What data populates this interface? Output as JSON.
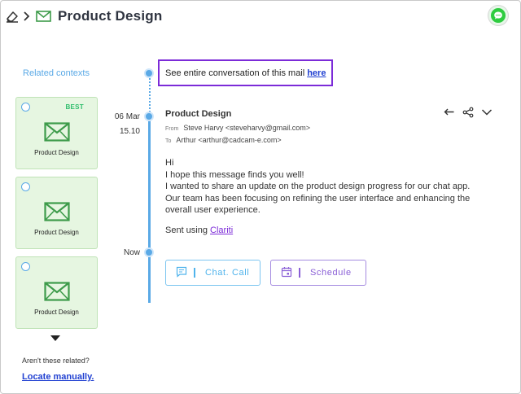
{
  "header": {
    "title": "Product Design",
    "icons": [
      "eraser-icon",
      "chevron-right-icon",
      "mail-icon",
      "chat-icon"
    ]
  },
  "sidebar": {
    "title": "Related contexts",
    "cards": [
      {
        "label": "Product Design",
        "badge": "BEST"
      },
      {
        "label": "Product Design",
        "badge": ""
      },
      {
        "label": "Product Design",
        "badge": ""
      }
    ],
    "not_related": "Aren't these related?",
    "locate": "Locate manually."
  },
  "timeline": {
    "date": "06 Mar",
    "time": "15.10",
    "now": "Now"
  },
  "conversation": {
    "text": "See entire conversation of this mail",
    "link": "here"
  },
  "email": {
    "subject": "Product Design",
    "from_label": "From",
    "from": "Steve Harvy <steveharvy@gmail.com>",
    "to_label": "To",
    "to": "Arthur <arthur@cadcam-e.com>",
    "body": [
      "Hi",
      "I hope this message finds you well!",
      "I wanted to share an update on the product design progress for our chat app.",
      "Our team has been focusing on refining the user interface and enhancing the",
      "overall user experience."
    ],
    "sent_prefix": "Sent using",
    "sent_app": "Clariti",
    "actions": [
      "reply-icon",
      "share-icon",
      "chevron-down-icon"
    ]
  },
  "buttons": {
    "chat_call": "Chat. Call",
    "schedule": "Schedule"
  },
  "colors": {
    "accent_blue": "#5aa9e6",
    "accent_purple": "#7c2bd8",
    "card_green": "#e6f6e1",
    "icon_green": "#3d9b4a",
    "badge_green": "#2ebd6b",
    "link_blue": "#1f3fd1"
  }
}
